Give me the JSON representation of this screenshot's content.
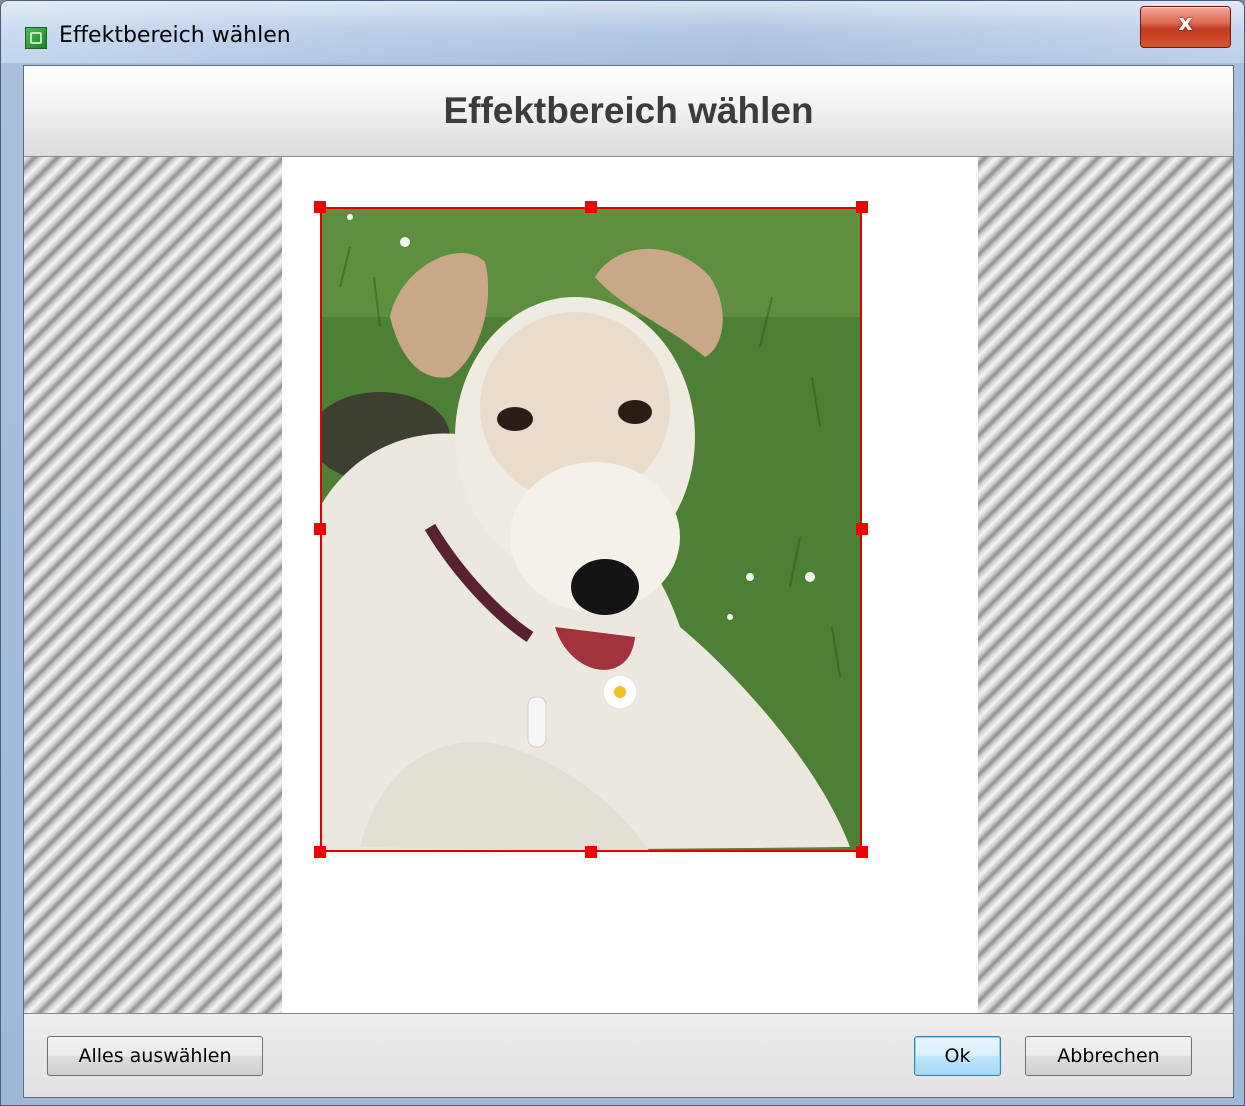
{
  "window": {
    "title": "Effektbereich wählen",
    "close_glyph": "x"
  },
  "header": {
    "title": "Effektbereich wählen"
  },
  "canvas": {
    "image_subject": "wire fox terrier lying in grass",
    "selection_color": "#e00000"
  },
  "footer": {
    "select_all_label": "Alles auswählen",
    "ok_label": "Ok",
    "cancel_label": "Abbrechen"
  },
  "colors": {
    "header_text": "#3c3c3c",
    "selection_handle": "#f00000",
    "default_button_border": "#3c7fb1"
  }
}
